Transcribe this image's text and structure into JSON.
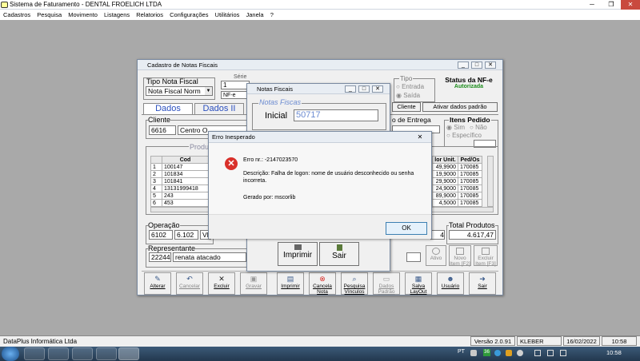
{
  "app": {
    "title": "Sistema de Faturamento - DENTAL FROELICH LTDA",
    "menu": [
      "Cadastros",
      "Pesquisa",
      "Movimento",
      "Listagens",
      "Relatorios",
      "Configurações",
      "Utilitários",
      "Janela",
      "?"
    ]
  },
  "cadastro": {
    "title": "Cadastro de Notas Fiscais",
    "tipo_nota_label": "Tipo Nota Fiscal",
    "tipo_nota_value": "Nota Fiscal Norm",
    "serie_label": "Série",
    "serie_value": "1",
    "serie_sub": "NF-e",
    "tipo_label": "Tipo",
    "tipo_entrada": "Entrada",
    "tipo_saida": "Saída",
    "status_label": "Status da NF-e",
    "status_value": "Autorizada",
    "tab_dados": "Dados",
    "tab_dados2": "Dados II",
    "cliente_label": "Cliente",
    "cliente_code": "6616",
    "cliente_name": "Centro O",
    "entrega_label": "o de Entrega",
    "itens_label": "Itens Pedido",
    "itens_sim": "Sim",
    "itens_nao": "Não",
    "itens_especifico": "Específico",
    "btn_cliente": "Cliente",
    "btn_ativar": "Ativar dados padrão",
    "produtos_label": "Produ",
    "grid_header": [
      "",
      "Cod"
    ],
    "grid_rows": [
      [
        "1",
        "100147"
      ],
      [
        "2",
        "101834"
      ],
      [
        "3",
        "101841"
      ],
      [
        "4",
        "13131999418"
      ],
      [
        "5",
        "243"
      ],
      [
        "6",
        "453"
      ]
    ],
    "grid_right_header": [
      "lor Unit.",
      "Ped/Os"
    ],
    "grid_right_rows": [
      [
        "49,9900",
        "170085"
      ],
      [
        "19,9000",
        "170085"
      ],
      [
        "29,9000",
        "170085"
      ],
      [
        "24,9000",
        "170085"
      ],
      [
        "89,9000",
        "170085"
      ],
      [
        "4,5000",
        "170085"
      ]
    ],
    "operacao_label": "Operação",
    "operacao_code": "6102",
    "operacao_value": "6.102",
    "operacao_extra": "VE",
    "operacao_right": "4",
    "total_label": "Total Produtos",
    "total_value": "4.617,47",
    "representante_label": "Representante",
    "rep_code": "22244",
    "rep_name": "renata atacado",
    "btn_ativo": "Ativo",
    "btn_novo": "Novo Item [F2]",
    "btn_excluir_item": "Excluir Item [F3]"
  },
  "toolbar": [
    {
      "label": "Alterar",
      "icon": "edit-icon"
    },
    {
      "label": "Cancelar",
      "icon": "undo-icon"
    },
    {
      "label": "Excluir",
      "icon": "delete-icon"
    },
    {
      "label": "Gravar",
      "icon": "save-icon"
    },
    {
      "label": "Imprimir",
      "icon": "print-icon"
    },
    {
      "label": "Cancela Nota",
      "icon": "cancel-icon"
    },
    {
      "label": "Pesquisa Vínculos",
      "icon": "search-icon"
    },
    {
      "label": "Dados Padrão",
      "icon": "document-icon"
    },
    {
      "label": "Salva LayOut",
      "icon": "layout-icon"
    },
    {
      "label": "Usuário",
      "icon": "user-icon"
    },
    {
      "label": "Sair",
      "icon": "exit-icon"
    }
  ],
  "notas": {
    "title": "Notas Fiscais",
    "group_label": "Notas Fiscas",
    "inicial_label": "Inicial",
    "inicial_value": "50717",
    "btn_imprimir": "Imprimir",
    "btn_sair": "Sair"
  },
  "error": {
    "title": "Erro Inesperado",
    "line1": "Erro nr.: -2147023570",
    "line2": "Descrição: Falha de logon: nome de usuário desconhecido ou senha incorreta.",
    "line3": "Gerado por: mscorlib",
    "ok": "OK"
  },
  "status": {
    "company": "DataPlus Informática Ltda",
    "version": "Versão 2.0.91",
    "user": "KLEBER",
    "date": "16/02/2022",
    "time": "10:58"
  },
  "taskbar": {
    "lang": "PT",
    "clock": "10:58",
    "badge": "36"
  },
  "colors": {
    "desktop": "#a9a9a9",
    "status_green": "#1a8c1a",
    "link_blue": "#2a4fbf",
    "error_red": "#d9302a"
  }
}
